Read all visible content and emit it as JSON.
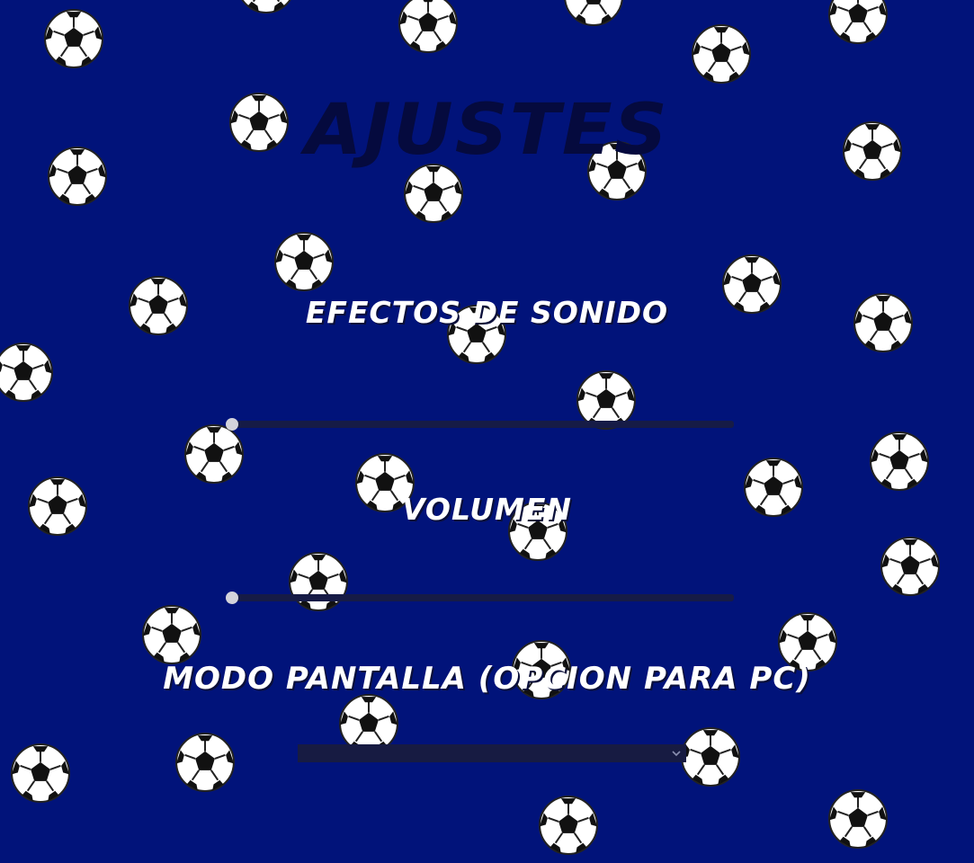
{
  "page": {
    "title": "AJUSTES",
    "background_color": "#01137a",
    "background_pattern": "soccer-ball-icon"
  },
  "settings": {
    "sound_effects": {
      "label": "EFECTOS DE SONIDO",
      "value": 0
    },
    "volume": {
      "label": "VOLUMEN",
      "value": 0
    },
    "screen_mode": {
      "label": "MODO PANTALLA (OPCION PARA PC)",
      "selected": ""
    }
  },
  "colors": {
    "title_text": "#050a3e",
    "label_text": "#ffffff",
    "slider_track": "#161b46",
    "slider_thumb": "#d3d3db",
    "select_background": "#171b42"
  }
}
